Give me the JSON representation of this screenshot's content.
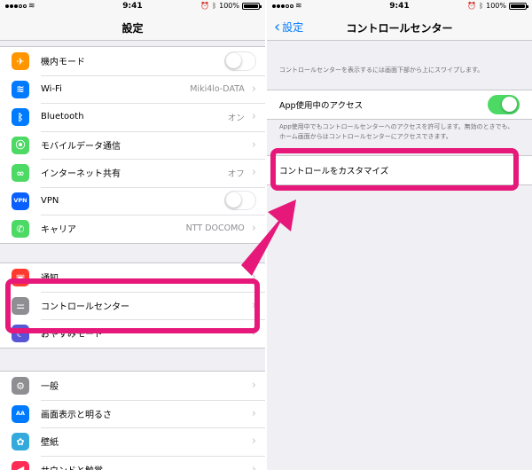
{
  "status_bar": {
    "time": "9:41",
    "battery": "100%"
  },
  "left": {
    "title": "設定",
    "group1": [
      {
        "label": "機内モード",
        "icon": "airplane-icon",
        "color": "#ff9500",
        "glyph": "✈",
        "toggle": "off"
      },
      {
        "label": "Wi-Fi",
        "icon": "wifi-icon",
        "color": "#007aff",
        "glyph": "≋",
        "value": "Miki4lo-DATA"
      },
      {
        "label": "Bluetooth",
        "icon": "bluetooth-icon",
        "color": "#007aff",
        "glyph": "ᛒ",
        "value": "オン"
      },
      {
        "label": "モバイルデータ通信",
        "icon": "cellular-icon",
        "color": "#4cd964",
        "glyph": "⦿",
        "value": ""
      },
      {
        "label": "インターネット共有",
        "icon": "hotspot-icon",
        "color": "#4cd964",
        "glyph": "∞",
        "value": "オフ"
      },
      {
        "label": "VPN",
        "icon": "vpn-icon",
        "color": "#0a60ff",
        "glyph": "VPN",
        "toggle": "off"
      },
      {
        "label": "キャリア",
        "icon": "phone-icon",
        "color": "#4cd964",
        "glyph": "✆",
        "value": "NTT DOCOMO"
      }
    ],
    "group2": [
      {
        "label": "通知",
        "icon": "notifications-icon",
        "color": "#ff3b30",
        "glyph": "▣"
      },
      {
        "label": "コントロールセンター",
        "icon": "control-center-icon",
        "color": "#8e8e93",
        "glyph": "⚌"
      },
      {
        "label": "おやすみモード",
        "icon": "moon-icon",
        "color": "#5856d6",
        "glyph": "☾"
      }
    ],
    "group3": [
      {
        "label": "一般",
        "icon": "gear-icon",
        "color": "#8e8e93",
        "glyph": "⚙"
      },
      {
        "label": "画面表示と明るさ",
        "icon": "display-icon",
        "color": "#007aff",
        "glyph": "AA"
      },
      {
        "label": "壁紙",
        "icon": "wallpaper-icon",
        "color": "#34aadc",
        "glyph": "✿"
      },
      {
        "label": "サウンドと触覚",
        "icon": "sound-icon",
        "color": "#ff2d55",
        "glyph": "◀"
      }
    ]
  },
  "right": {
    "back_label": "設定",
    "title": "コントロールセンター",
    "note1": "コントロールセンターを表示するには画面下部から上にスワイプします。",
    "access_label": "App使用中のアクセス",
    "access_toggle": "on",
    "note2": "App使用中でもコントロールセンターへのアクセスを許可します。無効のときでも、ホーム画面からはコントロールセンターにアクセスできます。",
    "customize_label": "コントロールをカスタマイズ"
  },
  "colors": {
    "highlight": "#e6187a",
    "accent": "#007aff",
    "toggle_on": "#4cd964"
  }
}
